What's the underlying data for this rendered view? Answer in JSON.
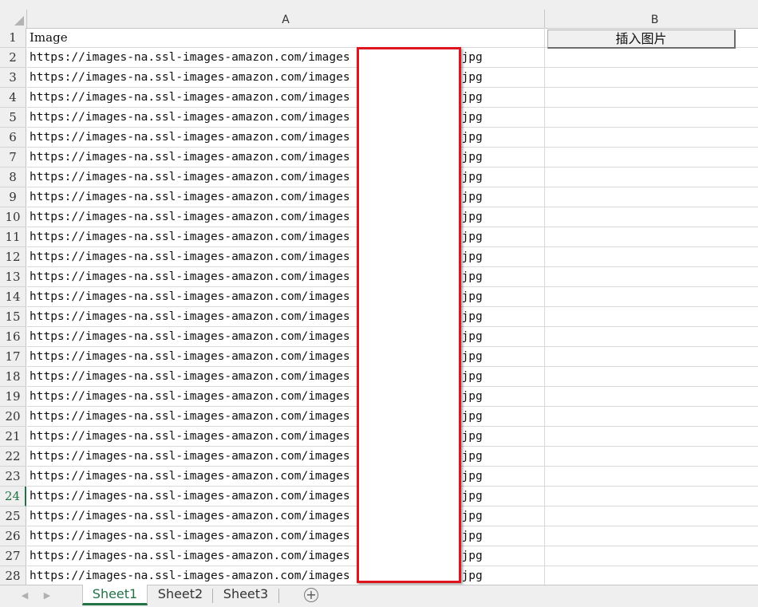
{
  "columns": {
    "a": "A",
    "b": "B"
  },
  "row_numbers": [
    "1",
    "2",
    "3",
    "4",
    "5",
    "6",
    "7",
    "8",
    "9",
    "10",
    "11",
    "12",
    "13",
    "14",
    "15",
    "16",
    "17",
    "18",
    "19",
    "20",
    "21",
    "22",
    "23",
    "24",
    "25",
    "26",
    "27",
    "28"
  ],
  "selected_row": "24",
  "cells": {
    "header": "Image",
    "url_prefix": "https://images-na.ssl-images-amazon.com/images",
    "url_suffix": "jpg"
  },
  "insert_button_label": "插入图片",
  "sheets": [
    "Sheet1",
    "Sheet2",
    "Sheet3"
  ],
  "active_sheet": "Sheet1",
  "add_sheet_glyph": "+",
  "colors": {
    "accent": "#217346",
    "redaction_border": "#e0141e"
  }
}
